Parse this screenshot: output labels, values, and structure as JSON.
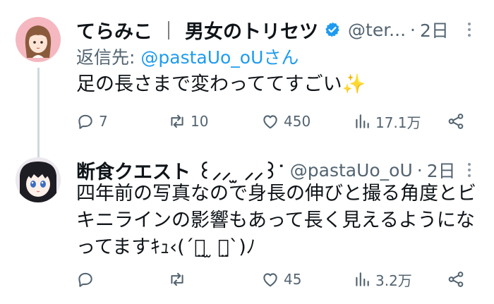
{
  "tweets": [
    {
      "display_name": "てらみこ",
      "separator": "｜",
      "display_name_2": "男女のトリセツ",
      "handle": "@ter...",
      "dot": "·",
      "time": "2日",
      "reply_prefix": "返信先: ",
      "reply_handle": "@pastaUo_oUさん",
      "text": "足の長さまで変わっててすごい✨",
      "actions": {
        "replies": "7",
        "retweets": "10",
        "likes": "450",
        "views": "17.1万"
      },
      "verified": true
    },
    {
      "display_name": "断食クエスト ꒰⸝⸝ ̫ ⸝⸝꒱ᐝ",
      "handle": "@pastaUo_oU",
      "dot": "·",
      "time": "2日",
      "text": "四年前の写真なので身長の伸びと撮る角度とビキニラインの影響もあって長く見えるようになってますｷｭ‹(´ฅ̤ ̫ ฅ̤`)ﾉ",
      "actions": {
        "replies": "",
        "retweets": "",
        "likes": "45",
        "views": "3.2万"
      }
    }
  ],
  "colors": {
    "accent": "#1d9bf0",
    "muted": "#536471",
    "text": "#0f1419",
    "verified": "#1d9bf0"
  },
  "icons": [
    "reply-icon",
    "retweet-icon",
    "like-icon",
    "views-icon",
    "share-icon",
    "more-icon",
    "verified-badge-icon",
    "sparkles-icon"
  ]
}
